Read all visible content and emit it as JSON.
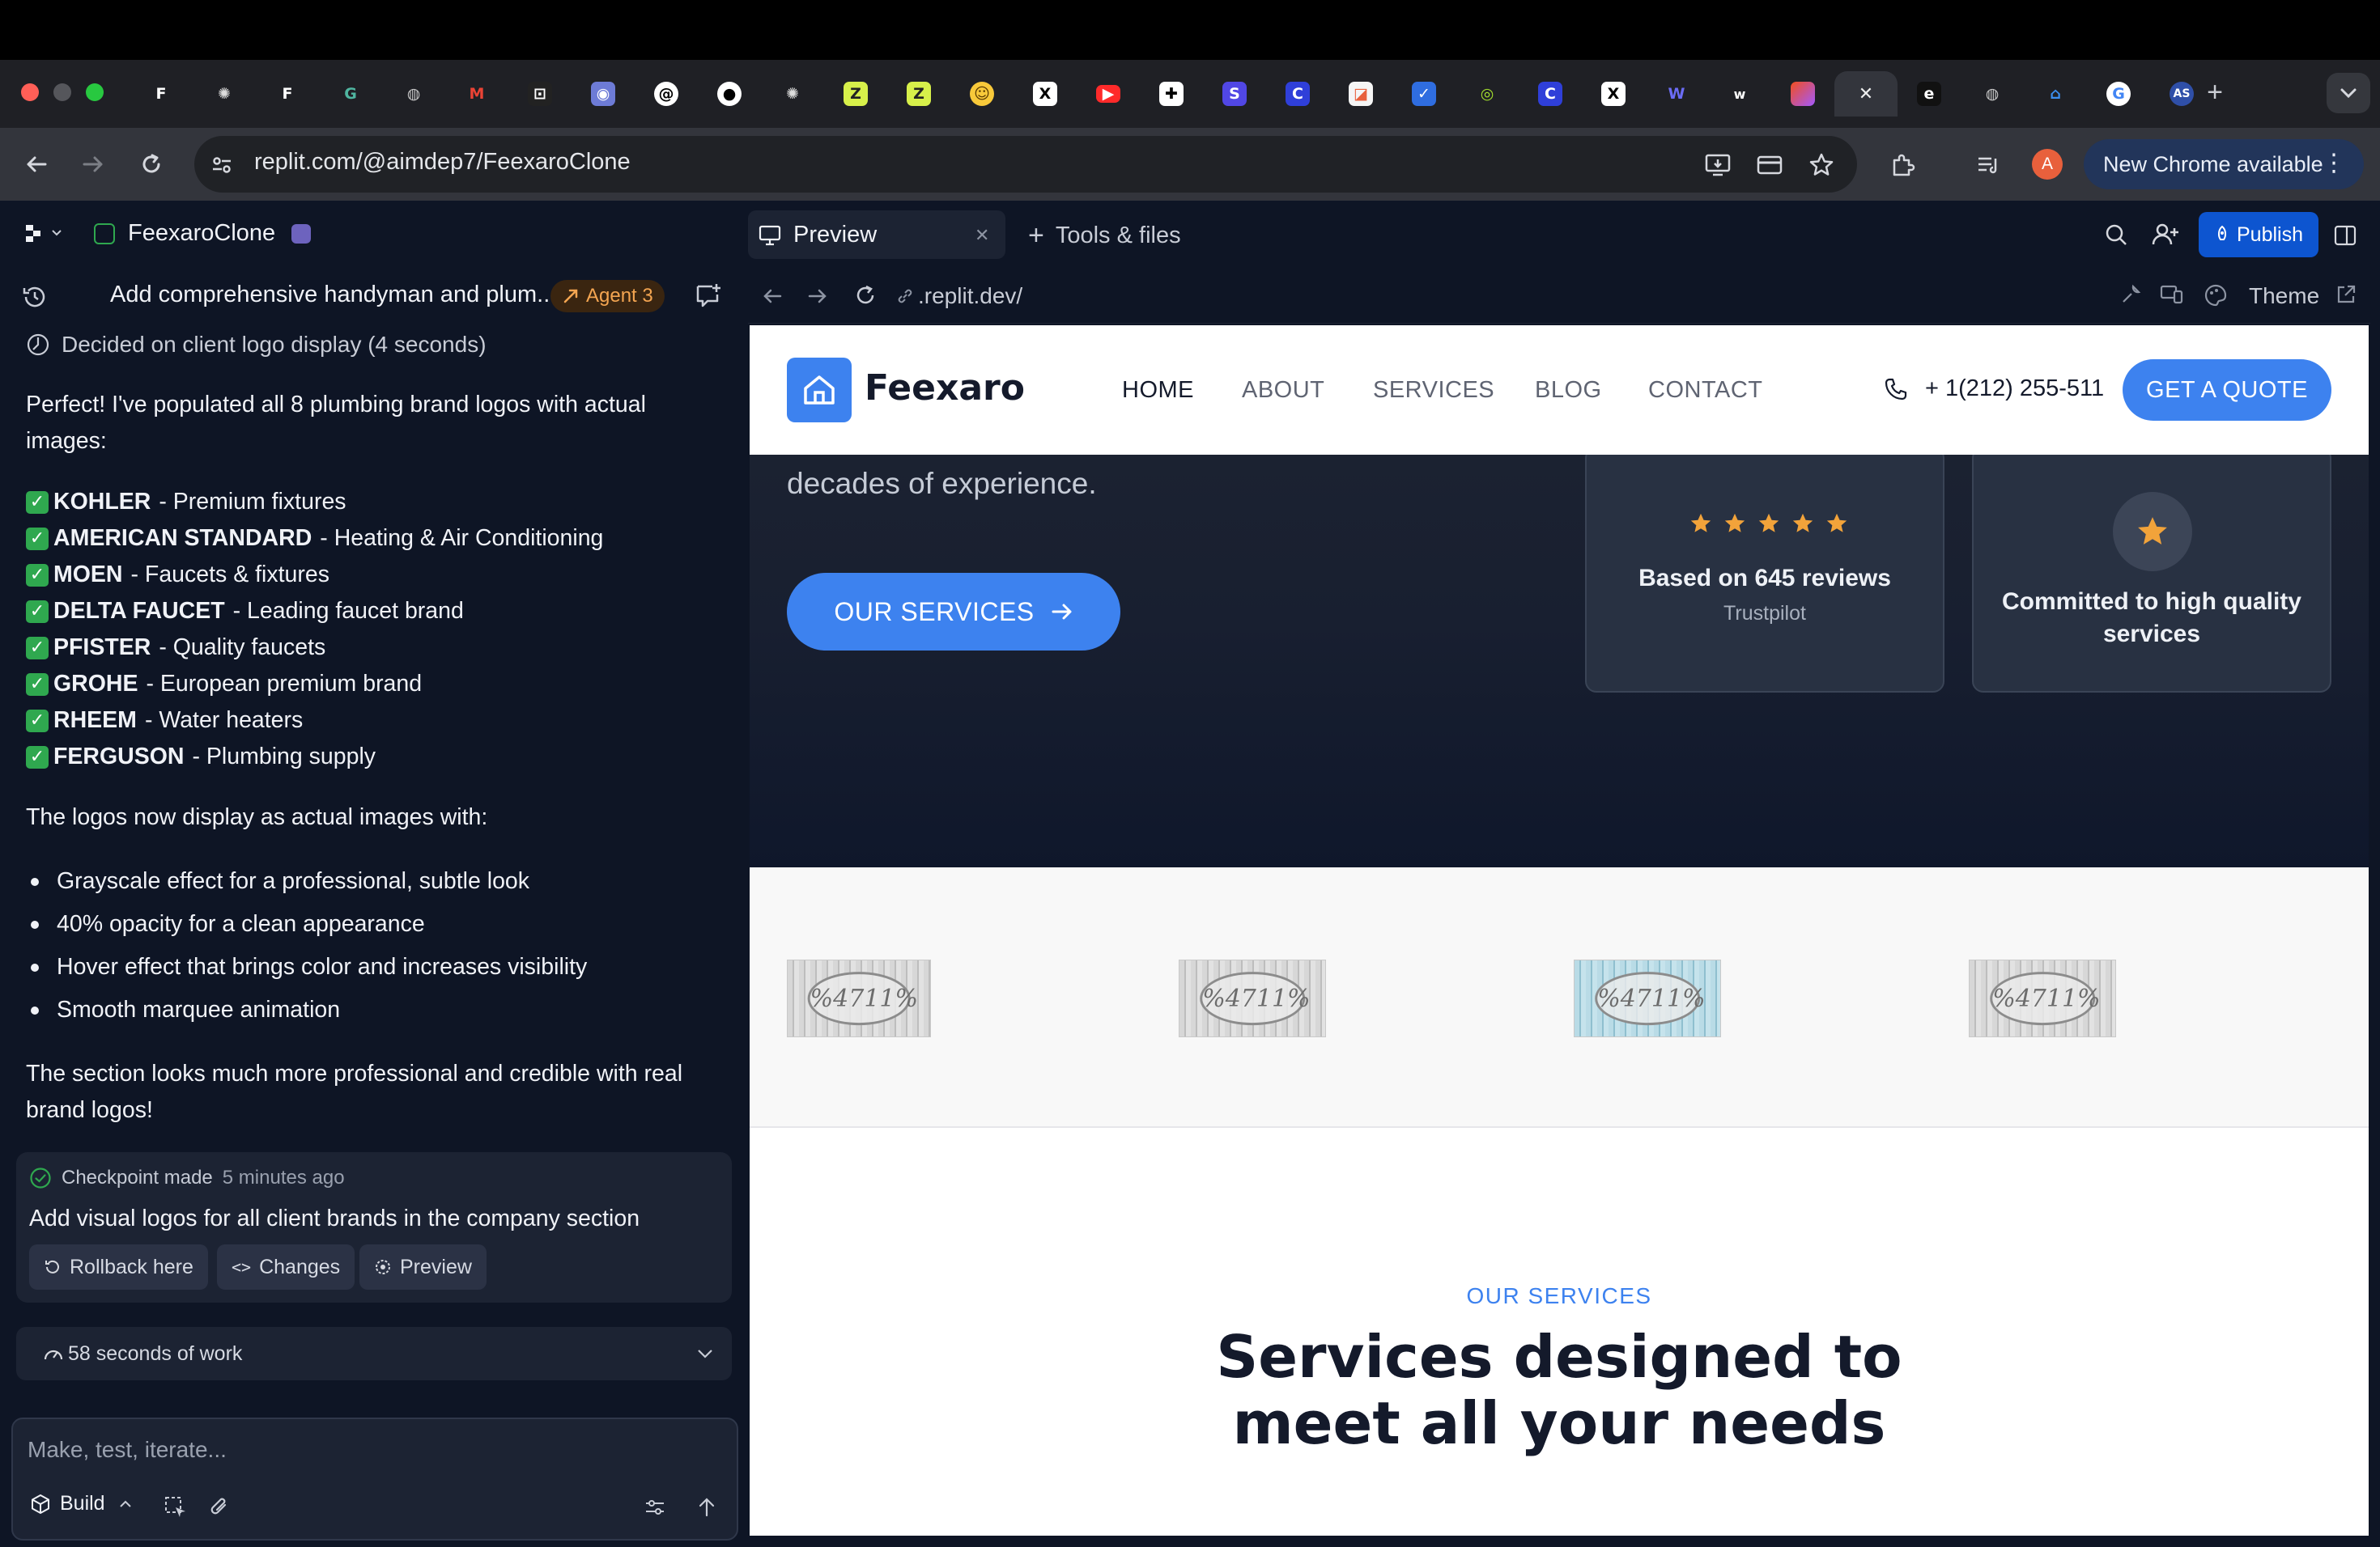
{
  "browser": {
    "tab_icons": [
      "feexaro",
      "openai",
      "feexaro",
      "grammarly",
      "globe",
      "gmail",
      "perplexity",
      "discord",
      "threads",
      "github",
      "openai",
      "ticktick",
      "ticktick",
      "huggingface",
      "x",
      "youtube",
      "notion",
      "stripe",
      "cursor",
      "google-photos",
      "todo",
      "grammarly-green",
      "cursor",
      "x",
      "webflow",
      "wordpress",
      "figma",
      "replit-active",
      "eleven",
      "globe",
      "linear",
      "google",
      "as"
    ],
    "url": "replit.com/@aimdep7/FeexaroClone",
    "profile_initial": "A",
    "update_label": "New Chrome available"
  },
  "workspace": {
    "project_name": "FeexaroClone",
    "chat_title": "Add comprehensive handyman and plum...",
    "agent_badge": "Agent 3",
    "thought": "Decided on client logo display (4 seconds)",
    "intro": "Perfect! I've populated all 8 plumbing brand logos with actual images:",
    "brands": [
      {
        "name": "KOHLER",
        "desc": "- Premium fixtures"
      },
      {
        "name": "AMERICAN STANDARD",
        "desc": "- Heating & Air Conditioning"
      },
      {
        "name": "MOEN",
        "desc": "- Faucets & fixtures"
      },
      {
        "name": "DELTA FAUCET",
        "desc": "- Leading faucet brand"
      },
      {
        "name": "PFISTER",
        "desc": "- Quality faucets"
      },
      {
        "name": "GROHE",
        "desc": "- European premium brand"
      },
      {
        "name": "RHEEM",
        "desc": "- Water heaters"
      },
      {
        "name": "FERGUSON",
        "desc": "- Plumbing supply"
      }
    ],
    "logos_intro": "The logos now display as actual images with:",
    "features": [
      "Grayscale effect for a professional, subtle look",
      "40% opacity for a clean appearance",
      "Hover effect that brings color and increases visibility",
      "Smooth marquee animation"
    ],
    "closing": "The section looks much more professional and credible with real brand logos!",
    "checkpoint": {
      "status": "Checkpoint made",
      "time": "5 minutes ago",
      "description": "Add visual logos for all client brands in the company section",
      "rollback": "Rollback here",
      "changes": "Changes",
      "preview": "Preview"
    },
    "work_time": "58 seconds of work",
    "composer_placeholder": "Make, test, iterate...",
    "build_label": "Build",
    "preview_tab": "Preview",
    "tools_tab": "Tools & files",
    "publish": "Publish",
    "preview_url": ".replit.dev/",
    "theme": "Theme"
  },
  "site": {
    "brand": "Feexaro",
    "nav": [
      "HOME",
      "ABOUT",
      "SERVICES",
      "BLOG",
      "CONTACT"
    ],
    "phone": "+ 1(212) 255-511",
    "quote": "GET A QUOTE",
    "hero_sub": "Expert plumbing, heating, and drain services with decades of experience.",
    "hero_button": "OUR SERVICES",
    "reviews_title": "Based on 645 reviews",
    "reviews_source": "Trustpilot",
    "rating_stars": 5,
    "commitment": "Committed to high quality services",
    "services_eyebrow": "OUR SERVICES",
    "services_title": "Services designed to meet all your needs",
    "colors": {
      "accent": "#3d82ef",
      "dark": "#141a2b",
      "star": "#f2a33a"
    }
  }
}
